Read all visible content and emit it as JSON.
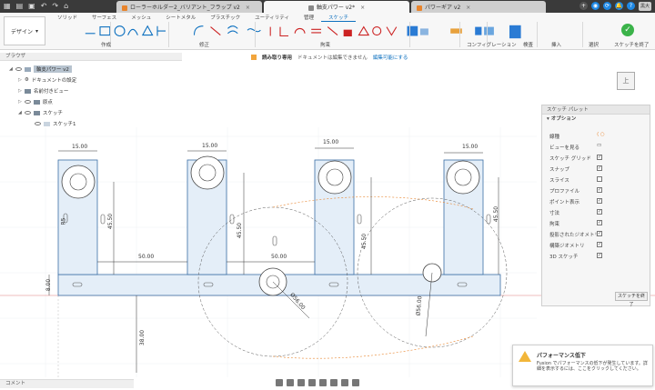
{
  "tabs": [
    {
      "label": "ローラーホルダー2_バリアント_フラップ v2"
    },
    {
      "label": "軸支パワー v2*"
    },
    {
      "label": "パワーギア v2"
    }
  ],
  "ribbon": {
    "design_label": "デザイン",
    "subtabs": [
      "ソリッド",
      "サーフェス",
      "メッシュ",
      "シートメタル",
      "プラスチック",
      "ユーティリティ",
      "管理",
      "スケッチ"
    ],
    "active_subtab": "スケッチ",
    "groups": [
      "作成",
      "修正",
      "拘束",
      "コンフィグレーション",
      "検査",
      "挿入",
      "選択",
      "スケッチを終了"
    ]
  },
  "browser": {
    "title": "ブラウザ",
    "nodes": [
      "軸支パワー v2",
      "ドキュメントの設定",
      "名前付きビュー",
      "原点",
      "スケッチ",
      "スケッチ1"
    ]
  },
  "readonly": {
    "label": "読み取り専用",
    "message": "ドキュメントは編集できません",
    "link": "編集可能にする"
  },
  "viewcube": {
    "label": "上"
  },
  "palette": {
    "title": "スケッチ パレット",
    "section": "オプション",
    "rows": [
      {
        "label": "線種",
        "checked": false
      },
      {
        "label": "ビューを見る",
        "checked": false
      },
      {
        "label": "スケッチ グリッド",
        "checked": true
      },
      {
        "label": "スナップ",
        "checked": true
      },
      {
        "label": "スライス",
        "checked": false
      },
      {
        "label": "プロファイル",
        "checked": true
      },
      {
        "label": "ポイント表示",
        "checked": true
      },
      {
        "label": "寸法",
        "checked": true
      },
      {
        "label": "拘束",
        "checked": true
      },
      {
        "label": "投影されたジオメトリ",
        "checked": true
      },
      {
        "label": "構築ジオメトリ",
        "checked": true
      },
      {
        "label": "3D スケッチ",
        "checked": true
      }
    ],
    "finish": "スケッチを終了"
  },
  "toast": {
    "title": "パフォーマンス低下",
    "body": "Fusion でパフォーマンスの低下が発生しています。詳細を表示するには、ここをクリックしてください。"
  },
  "comment": "コメント",
  "dims": [
    "15.00",
    "15.00",
    "15.00",
    "15.00",
    "50.00",
    "50.00",
    "45.50",
    "45.50",
    "45.50",
    "45.50",
    "8.00",
    "38.00",
    "Ø56.00",
    "Ø56.00",
    "R5"
  ]
}
